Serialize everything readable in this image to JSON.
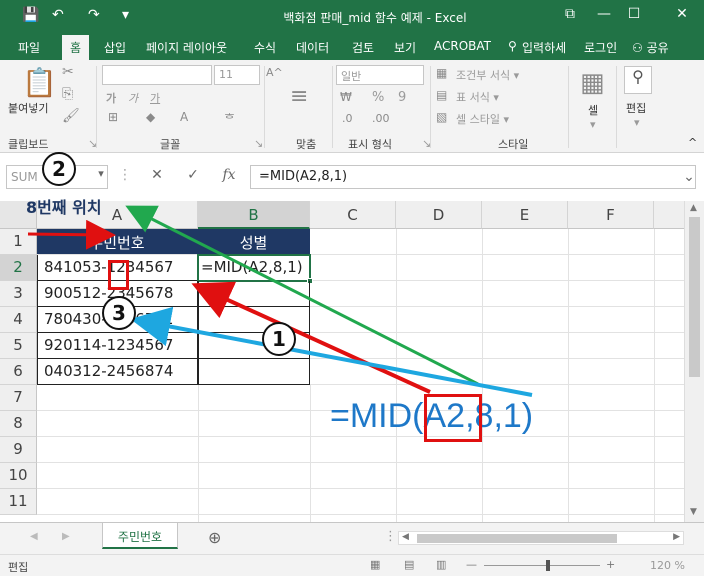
{
  "titlebar": {
    "title": "백화점 판매_mid 함수 예제 - Excel",
    "save_icon": "💾",
    "undo_icon": "↶",
    "redo_icon": "↷",
    "customize_icon": "▾",
    "ribbon_display_icon": "⧉",
    "minimize_icon": "—",
    "maximize_icon": "☐",
    "close_icon": "✕"
  },
  "tabs": [
    {
      "label": "파일"
    },
    {
      "label": "홈"
    },
    {
      "label": "삽입"
    },
    {
      "label": "페이지 레이아웃"
    },
    {
      "label": "수식"
    },
    {
      "label": "데이터"
    },
    {
      "label": "검토"
    },
    {
      "label": "보기"
    },
    {
      "label": "ACROBAT"
    },
    {
      "label": "입력하세"
    },
    {
      "label": "로그인"
    },
    {
      "label": "공유"
    }
  ],
  "ribbon": {
    "paste_label": "붙여넣기",
    "font_size": "11",
    "bold": "가",
    "italic": "가",
    "underline": "가",
    "number_format": "일반",
    "percent": "%",
    "comma": "9",
    "conditional_format": "조건부 서식 ▾",
    "table_format": "표 서식 ▾",
    "cell_style": "셀 스타일 ▾",
    "cells_label": "셀",
    "editing_label": "편집",
    "groups": {
      "clipboard": "클립보드",
      "font": "글꼴",
      "alignment": "맞춤",
      "number": "표시 형식",
      "styles": "스타일"
    },
    "collapse_icon": "^"
  },
  "formula_bar": {
    "name_box": "SUM",
    "cancel_icon": "✕",
    "enter_icon": "✓",
    "fx_icon": "fx",
    "formula": "=MID(A2,8,1)",
    "expand_icon": "⌄"
  },
  "grid": {
    "columns": [
      "A",
      "B",
      "C",
      "D",
      "E",
      "F"
    ],
    "rows": [
      "1",
      "2",
      "3",
      "4",
      "5",
      "6",
      "7",
      "8",
      "9",
      "10",
      "11"
    ],
    "header_cells": [
      "주민번호",
      "성별"
    ],
    "data_rows": [
      {
        "a": "841053-1234567",
        "b": "=MID(A2,8,1)"
      },
      {
        "a": "900512-2345678",
        "b": ""
      },
      {
        "a": "780430-3456781",
        "b": ""
      },
      {
        "a": "920114-1234567",
        "b": ""
      },
      {
        "a": "040312-2456874",
        "b": ""
      }
    ]
  },
  "sheets": {
    "tabs": [
      {
        "label": "주민번호"
      }
    ],
    "add_icon": "⊕",
    "prev_icon": "◀",
    "next_icon": "▶",
    "more_icon": "⋮"
  },
  "statusbar": {
    "mode": "편집",
    "zoom": "120 %",
    "zoom_minus": "—",
    "zoom_plus": "+"
  },
  "annotations": {
    "num1": "1",
    "num2": "2",
    "num3": "3",
    "position_label": "8번째 위치",
    "big_formula": "=MID(A2,8,1)",
    "colors": {
      "red": "#e01010",
      "green": "#21a84e",
      "blue": "#1ea7e0",
      "formula": "#1e78c8"
    }
  },
  "colors": {
    "excel_green": "#217346",
    "header_fill": "#1f3864"
  }
}
